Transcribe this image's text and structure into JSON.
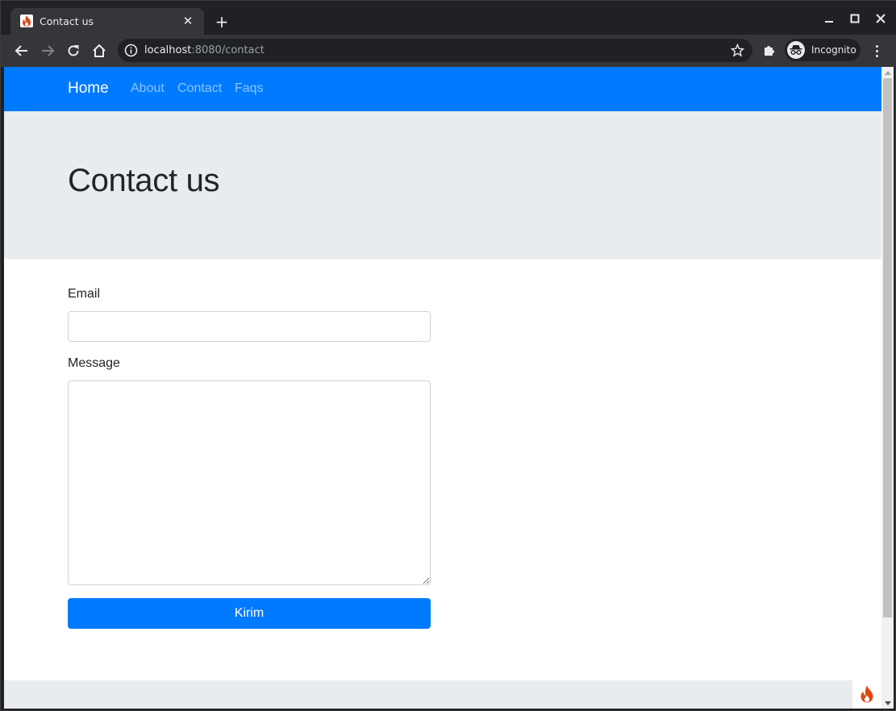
{
  "browser": {
    "tab": {
      "title": "Contact us",
      "favicon": "codeigniter-flame-icon"
    },
    "new_tab_label": "+",
    "address": {
      "host": "localhost",
      "rest": ":8080/contact"
    },
    "profile_label": "Incognito",
    "icons": [
      "back-icon",
      "forward-icon",
      "reload-icon",
      "home-icon",
      "info-icon",
      "star-icon",
      "extensions-icon",
      "incognito-icon",
      "menu-icon",
      "minimize-icon",
      "maximize-icon",
      "close-icon"
    ]
  },
  "navbar": {
    "brand": "Home",
    "links": [
      {
        "label": "About"
      },
      {
        "label": "Contact"
      },
      {
        "label": "Faqs"
      }
    ],
    "bg_color": "#007bff"
  },
  "jumbotron": {
    "title": "Contact us"
  },
  "form": {
    "email_label": "Email",
    "email_value": "",
    "email_placeholder": "",
    "message_label": "Message",
    "message_value": "",
    "message_placeholder": "",
    "submit_label": "Kirim"
  }
}
